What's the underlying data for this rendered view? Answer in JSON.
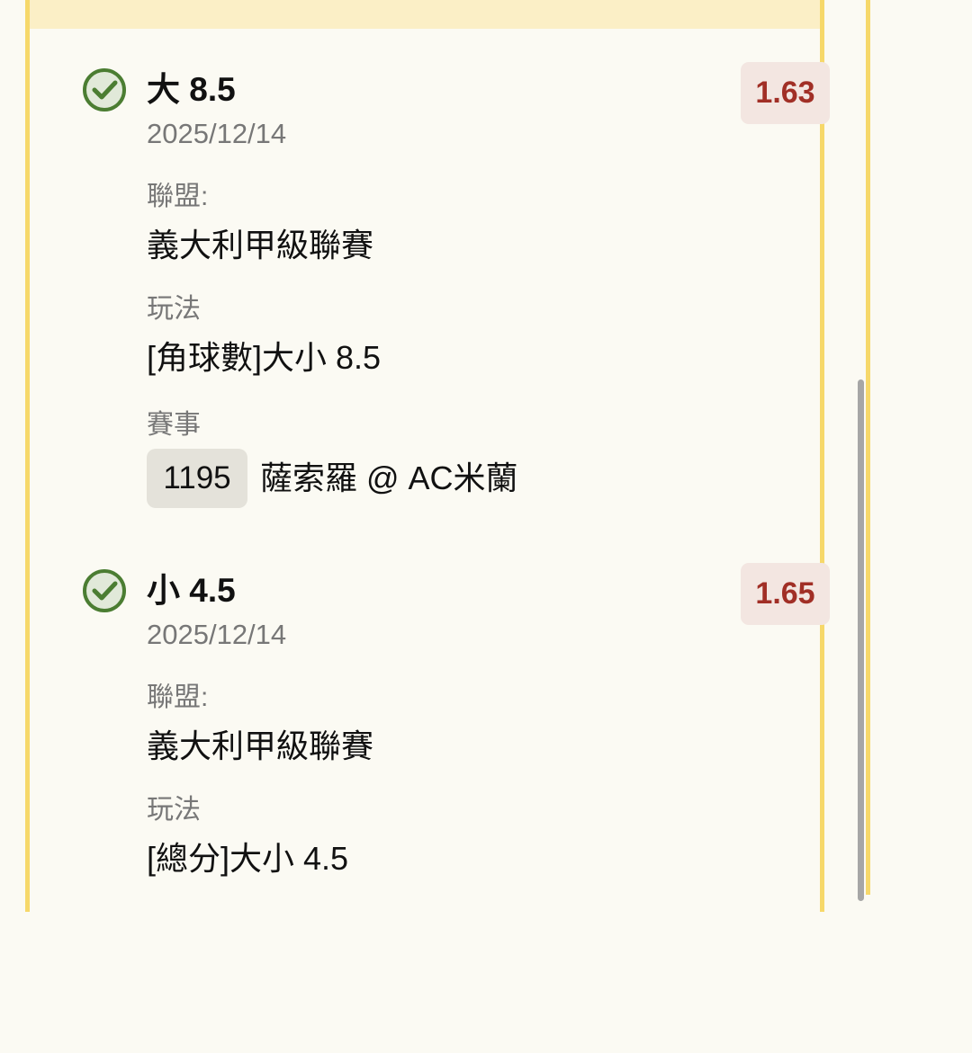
{
  "bets": [
    {
      "selection": "大 8.5",
      "date": "2025/12/14",
      "odds": "1.63",
      "league_label": "聯盟:",
      "league": "義大利甲級聯賽",
      "play_label": "玩法",
      "play": "[角球數]大小 8.5",
      "event_label": "賽事",
      "event_id": "1195",
      "event_name": "薩索羅 @ AC米蘭"
    },
    {
      "selection": "小 4.5",
      "date": "2025/12/14",
      "odds": "1.65",
      "league_label": "聯盟:",
      "league": "義大利甲級聯賽",
      "play_label": "玩法",
      "play": "[總分]大小 4.5"
    }
  ],
  "colors": {
    "accent_border": "#f6d86a",
    "header_fill": "#fbefc6",
    "odds_text": "#a12f26",
    "odds_fill": "#f3e6e1",
    "check": "#4b7d32"
  },
  "icons": {
    "status": "check-circle-icon"
  }
}
